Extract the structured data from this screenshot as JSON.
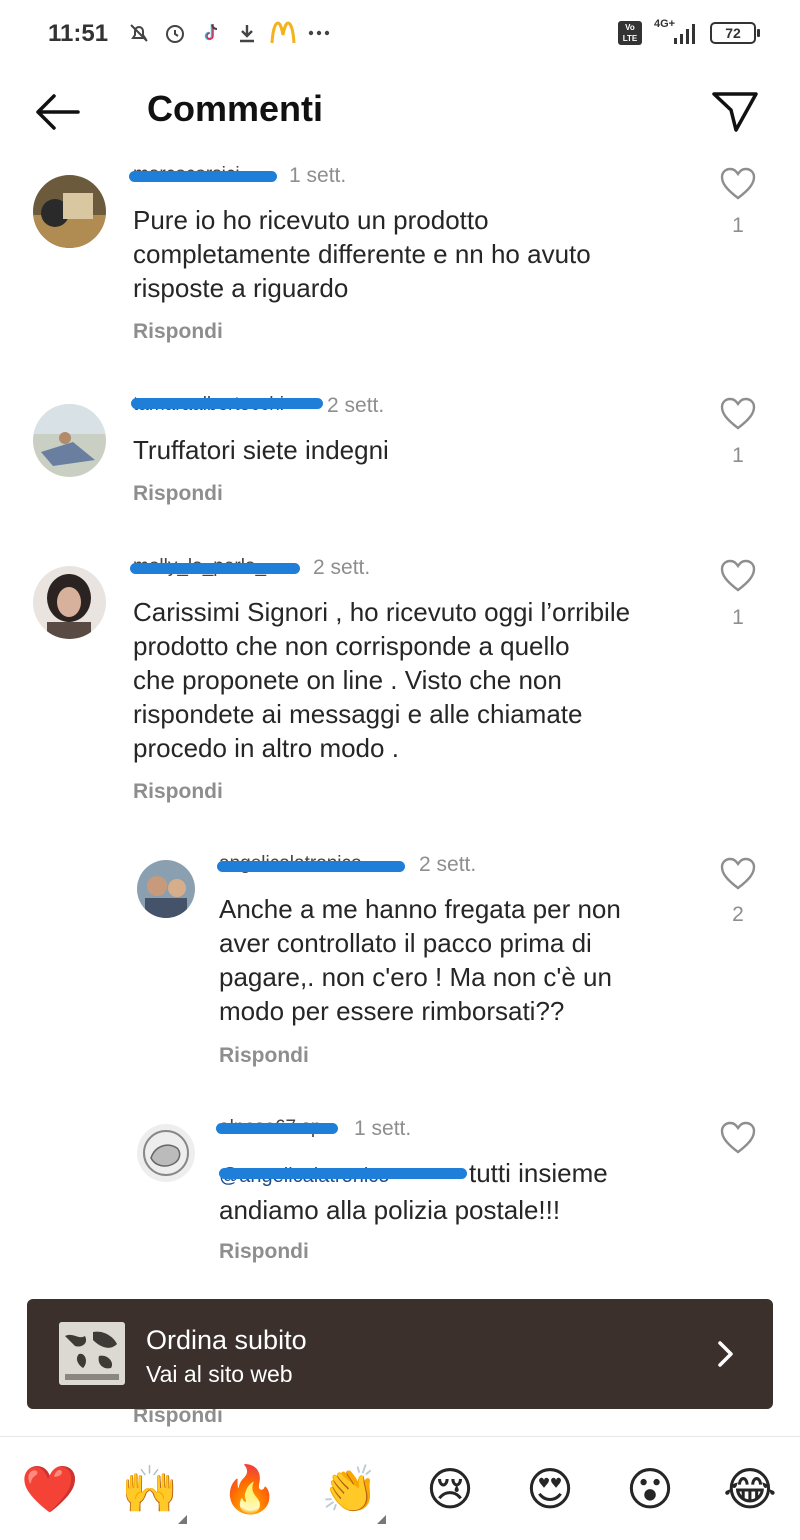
{
  "status_bar": {
    "time": "11:51",
    "network": "4G+",
    "volte": "Vo LTE",
    "battery": "72"
  },
  "header": {
    "title": "Commenti"
  },
  "comments": [
    {
      "username": "marcocorsici",
      "time": "1 sett.",
      "text_lines": [
        "Pure io ho ricevuto un prodotto",
        "completamente differente e nn ho avuto",
        "risposte a riguardo"
      ],
      "reply_label": "Rispondi",
      "likes": "1"
    },
    {
      "username": "tamaraalbertocchi",
      "time": "2 sett.",
      "text_lines": [
        "Truffatori siete indegni"
      ],
      "reply_label": "Rispondi",
      "likes": "1"
    },
    {
      "username": "molly_la_perla_",
      "time": "2 sett.",
      "text_lines": [
        "Carissimi Signori , ho ricevuto oggi l’orribile",
        "prodotto che non corrisponde a quello",
        "che proponete on line . Visto che non",
        "rispondete ai messaggi e alle chiamate",
        "procedo in altro modo ."
      ],
      "reply_label": "Rispondi",
      "likes": "1"
    },
    {
      "username": "angelicalatronico",
      "time": "2 sett.",
      "text_lines": [
        "Anche a me hanno fregata per non",
        "aver controllato il pacco prima di",
        "pagare,. non c'ero ! Ma non c'è un",
        "modo per essere rimborsati??"
      ],
      "reply_label": "Rispondi",
      "likes": "2"
    },
    {
      "username": "alnoso67.sp",
      "time": "1 sett.",
      "mention": "@angelicalatronico",
      "text_first": "tutti insieme",
      "text_lines": [
        "andiamo alla polizia postale!!!"
      ],
      "reply_label": "Rispondi",
      "likes": ""
    }
  ],
  "ad": {
    "title": "Ordina subito",
    "subtitle": "Vai al sito web"
  },
  "hidden_reply": "Rispondi",
  "emoji_bar": [
    "❤️",
    "🙌",
    "🔥",
    "👏",
    "😢",
    "😍",
    "😮",
    "😂"
  ],
  "colors": {
    "redaction": "#1e7ed8",
    "ad_background": "#3b302c",
    "secondary_text": "#8e8e8e"
  }
}
